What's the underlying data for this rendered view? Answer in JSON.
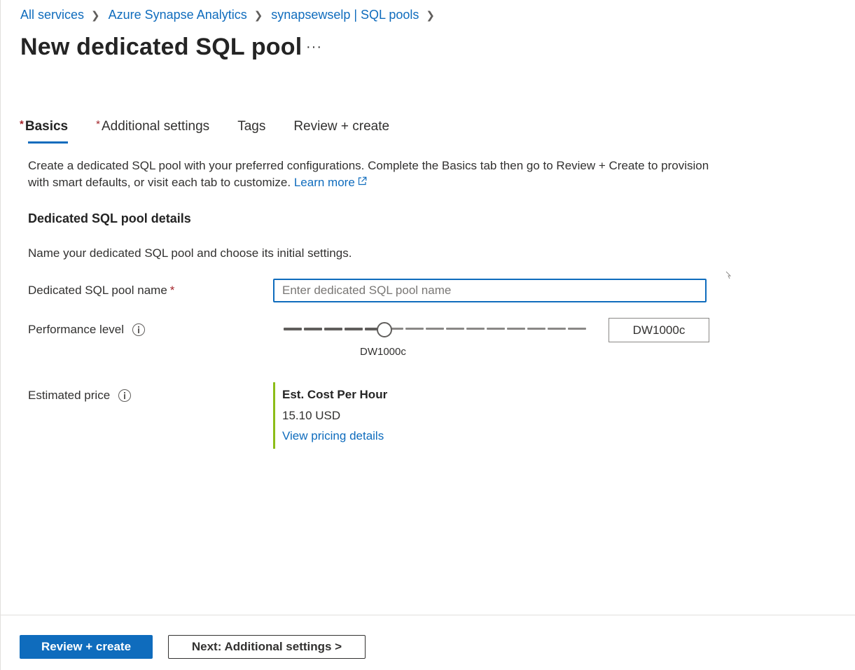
{
  "breadcrumb": {
    "items": [
      {
        "label": "All services"
      },
      {
        "label": "Azure Synapse Analytics"
      },
      {
        "label": "synapsewselp | SQL pools"
      }
    ]
  },
  "page": {
    "title": "New dedicated SQL pool",
    "more_label": "···"
  },
  "tabs": [
    {
      "label": "Basics",
      "required": true,
      "active": true
    },
    {
      "label": "Additional settings",
      "required": true,
      "active": false
    },
    {
      "label": "Tags",
      "required": false,
      "active": false
    },
    {
      "label": "Review + create",
      "required": false,
      "active": false
    }
  ],
  "intro": {
    "text": "Create a dedicated SQL pool with your preferred configurations. Complete the Basics tab then go to Review + Create to provision with smart defaults, or visit each tab to customize.",
    "learn_more": "Learn more"
  },
  "section": {
    "title": "Dedicated SQL pool details",
    "description": "Name your dedicated SQL pool and choose its initial settings."
  },
  "form": {
    "pool_name": {
      "label": "Dedicated SQL pool name",
      "required_mark": "*",
      "value": "",
      "placeholder": "Enter dedicated SQL pool name"
    },
    "performance": {
      "label": "Performance level",
      "value": "DW1000c",
      "selected_index": 5,
      "total_steps": 16
    },
    "price": {
      "label": "Estimated price",
      "title": "Est. Cost Per Hour",
      "value": "15.10 USD",
      "link": "View pricing details"
    }
  },
  "footer": {
    "primary_label": "Review + create",
    "secondary_label": "Next: Additional settings >"
  },
  "colors": {
    "accent": "#0f6cbd",
    "required": "#a4262c",
    "price_bar": "#8cbd18",
    "slider_filled": "#605e5c",
    "slider_empty": "#8a8886"
  }
}
